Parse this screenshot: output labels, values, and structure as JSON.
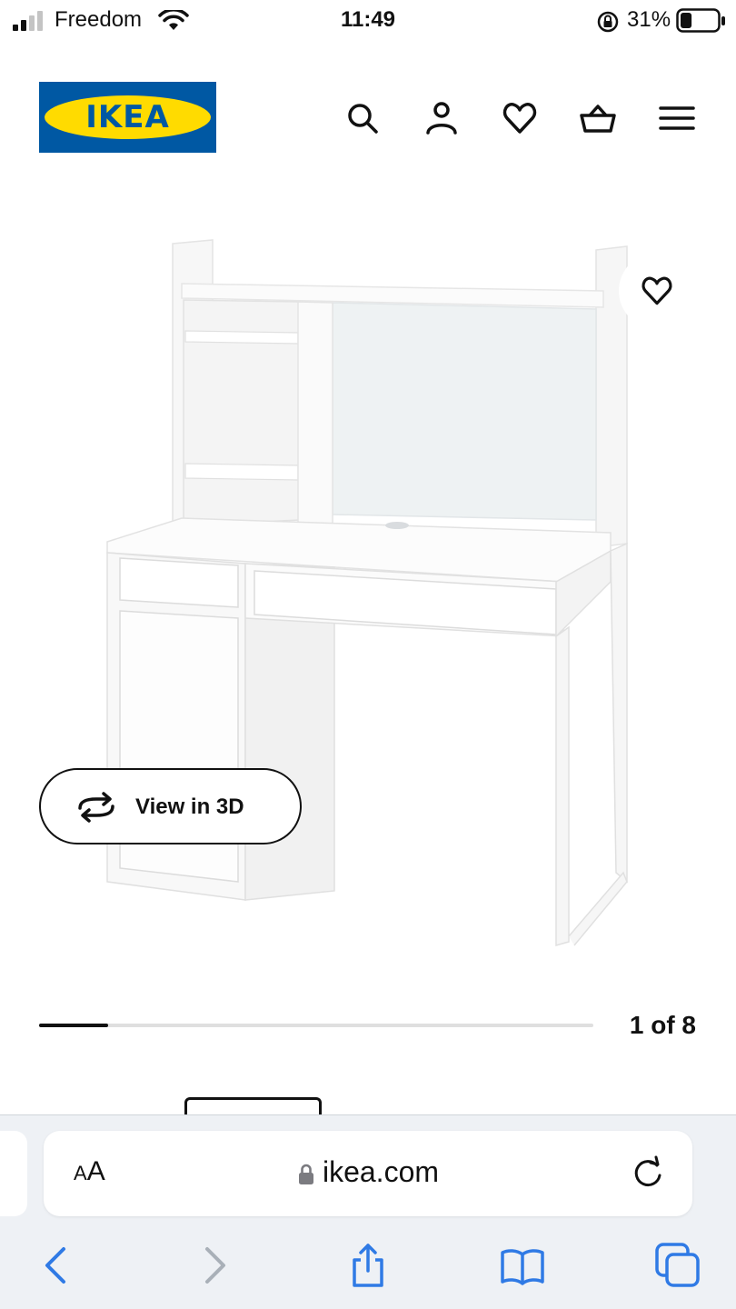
{
  "status_bar": {
    "carrier": "Freedom",
    "time": "11:49",
    "battery_percent": "31%",
    "battery_level": 0.31,
    "signal_bars": 2,
    "icons": [
      "signal-icon",
      "wifi-icon",
      "orientation-lock-icon",
      "battery-icon"
    ]
  },
  "header": {
    "logo_text": "IKEA",
    "brand_colors": {
      "blue": "#0058a3",
      "yellow": "#ffdb00"
    },
    "icons": [
      "search-icon",
      "account-icon",
      "favourites-icon",
      "basket-icon",
      "menu-icon"
    ]
  },
  "product": {
    "view_3d_label": "View in 3D",
    "favourite_icon": "heart-icon",
    "image_icon": "desk-with-hutch-illustration"
  },
  "carousel": {
    "position_text": "1 of 8",
    "current": 1,
    "total": 8,
    "progress_fraction": 0.125
  },
  "safari": {
    "aa_label_small": "A",
    "aa_label_large": "A",
    "url": "ikea.com",
    "accent_color": "#2f7ae5",
    "toolbar_icons": [
      "back-icon",
      "forward-icon",
      "share-icon",
      "bookmarks-icon",
      "tabs-icon"
    ]
  }
}
